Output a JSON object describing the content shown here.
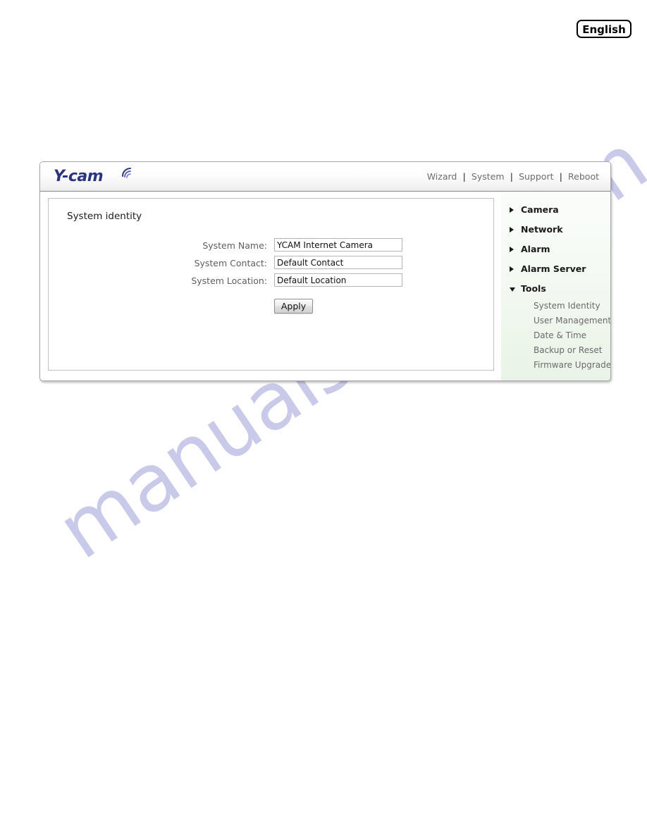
{
  "language_button": {
    "label": "English"
  },
  "panel": {
    "logo": {
      "text": "Y-cam",
      "icon": "wifi-signal-icon"
    },
    "top_nav": [
      {
        "label": "Wizard"
      },
      {
        "label": "System"
      },
      {
        "label": "Support"
      },
      {
        "label": "Reboot"
      }
    ],
    "nav_separator": "|"
  },
  "content": {
    "title": "System identity",
    "fields": [
      {
        "label": "System Name:",
        "value": "YCAM Internet Camera",
        "placeholder": ""
      },
      {
        "label": "System Contact:",
        "value": "Default Contact",
        "placeholder": ""
      },
      {
        "label": "System Location:",
        "value": "Default Location",
        "placeholder": ""
      }
    ],
    "apply_label": "Apply"
  },
  "sidebar": {
    "menu": [
      {
        "label": "Camera",
        "expanded": false,
        "icon": "triangle-right-icon",
        "items": []
      },
      {
        "label": "Network",
        "expanded": false,
        "icon": "triangle-right-icon",
        "items": []
      },
      {
        "label": "Alarm",
        "expanded": false,
        "icon": "triangle-right-icon",
        "items": []
      },
      {
        "label": "Alarm Server",
        "expanded": false,
        "icon": "triangle-right-icon",
        "items": []
      },
      {
        "label": "Tools",
        "expanded": true,
        "icon": "triangle-down-icon",
        "items": [
          {
            "label": "System Identity"
          },
          {
            "label": "User Management"
          },
          {
            "label": "Date & Time"
          },
          {
            "label": "Backup or Reset"
          },
          {
            "label": "Firmware Upgrade"
          }
        ]
      }
    ]
  },
  "watermark": {
    "text": "manualshive.com",
    "color": "#c9c9ea"
  },
  "colors": {
    "logo_blue": "#2b3480",
    "sidebar_bg": "#eef6ec",
    "label_gray": "#5e5e5e",
    "nav_gray": "#6d6d6d"
  }
}
